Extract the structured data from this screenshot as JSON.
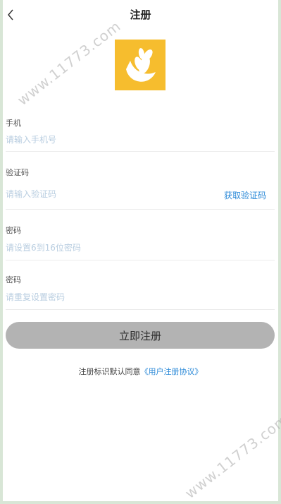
{
  "header": {
    "back_icon": "chevron-left-icon",
    "title": "注册"
  },
  "logo": {
    "icon": "wheat-leaf-icon",
    "color": "#f6bd2e"
  },
  "form": {
    "phone": {
      "label": "手机",
      "placeholder": "请输入手机号"
    },
    "code": {
      "label": "验证码",
      "placeholder": "请输入验证码",
      "get_code_label": "获取验证码"
    },
    "password": {
      "label": "密码",
      "placeholder": "请设置6到16位密码"
    },
    "confirm": {
      "label": "密码",
      "placeholder": "请重复设置密码"
    }
  },
  "submit_label": "立即注册",
  "agreement": {
    "prefix": "注册标识默认同意",
    "link": "《用户注册协议》"
  },
  "watermark": "www.11773.com",
  "colors": {
    "accent": "#2c8ad8",
    "button": "#b3b3b3",
    "placeholder": "#b8cde0"
  }
}
